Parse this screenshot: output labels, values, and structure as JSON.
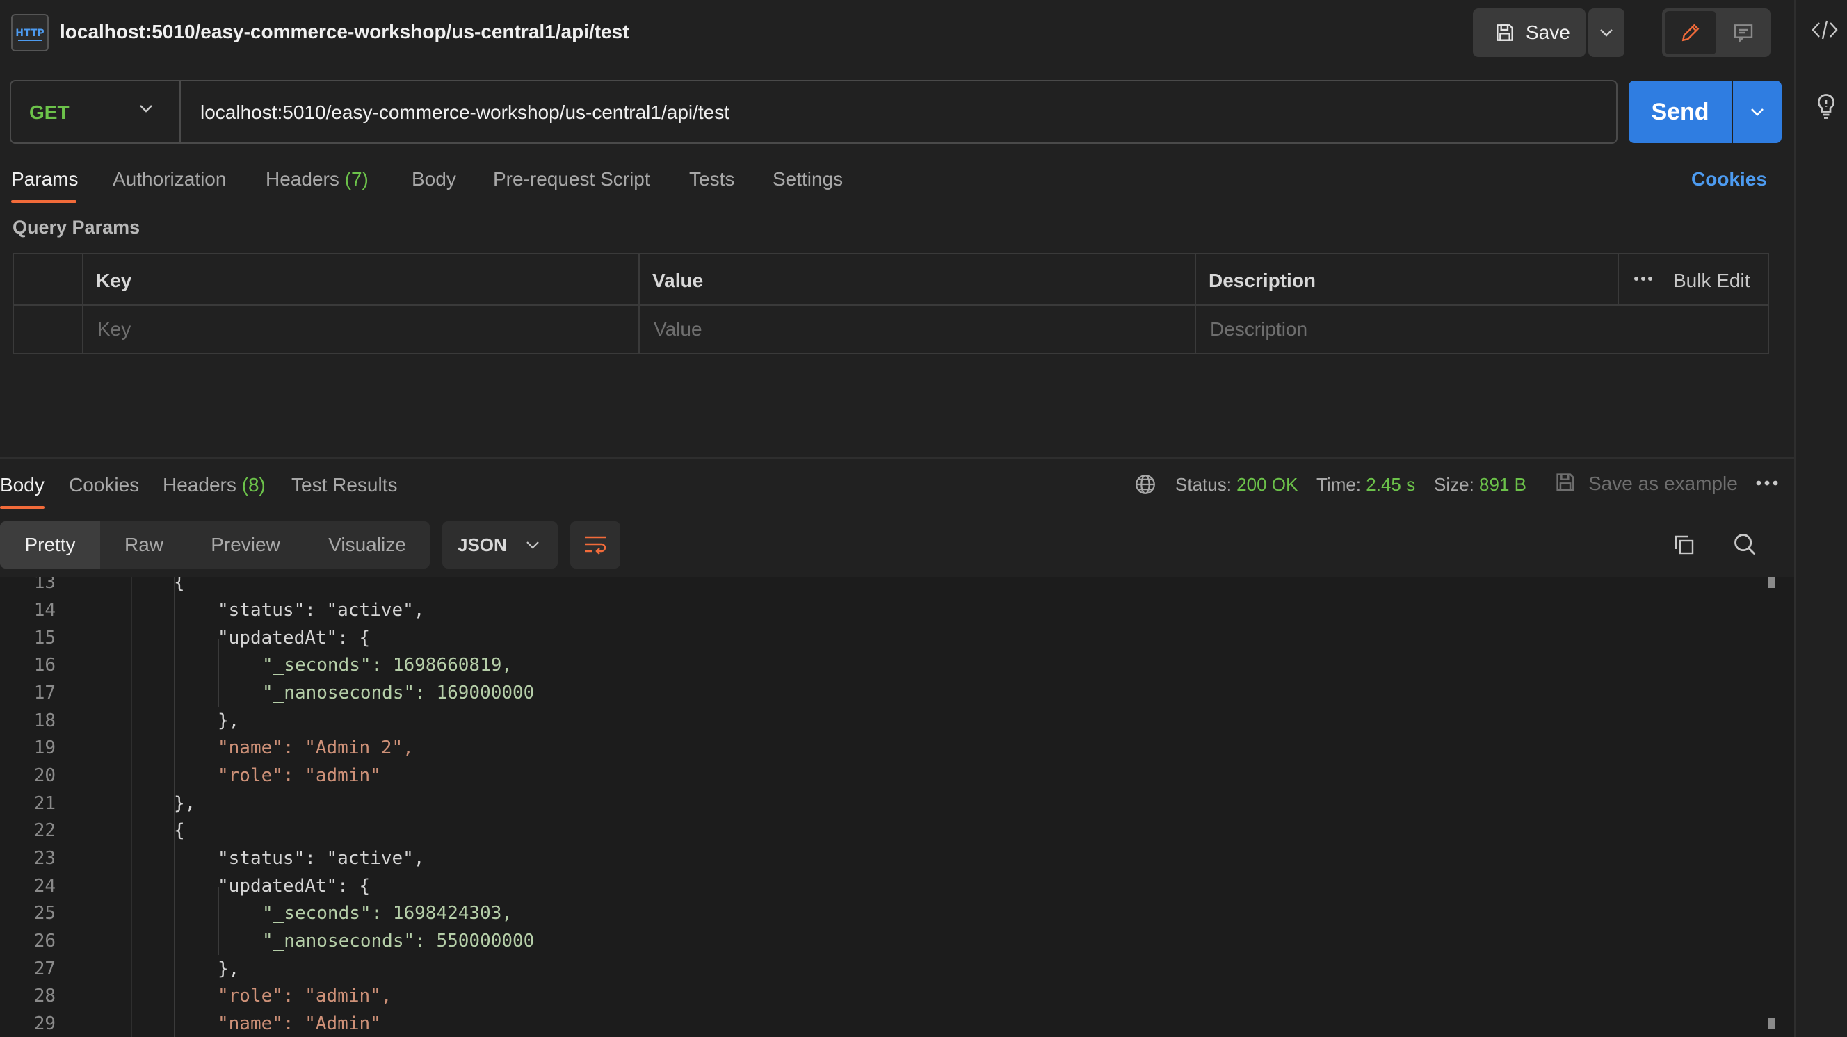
{
  "request": {
    "title": "localhost:5010/easy-commerce-workshop/us-central1/api/test",
    "method": "GET",
    "url": "localhost:5010/easy-commerce-workshop/us-central1/api/test",
    "save_label": "Save",
    "send_label": "Send"
  },
  "request_tabs": [
    {
      "label": "Params",
      "count": ""
    },
    {
      "label": "Authorization",
      "count": ""
    },
    {
      "label": "Headers",
      "count": "(7)"
    },
    {
      "label": "Body",
      "count": ""
    },
    {
      "label": "Pre-request Script",
      "count": ""
    },
    {
      "label": "Tests",
      "count": ""
    },
    {
      "label": "Settings",
      "count": ""
    }
  ],
  "cookies_link": "Cookies",
  "query_params": {
    "title": "Query Params",
    "headers": {
      "key": "Key",
      "value": "Value",
      "description": "Description",
      "bulk_edit": "Bulk Edit"
    },
    "placeholders": {
      "key": "Key",
      "value": "Value",
      "description": "Description"
    }
  },
  "response_tabs": [
    {
      "label": "Body",
      "count": ""
    },
    {
      "label": "Cookies",
      "count": ""
    },
    {
      "label": "Headers",
      "count": "(8)"
    },
    {
      "label": "Test Results",
      "count": ""
    }
  ],
  "response_status": {
    "status_label": "Status:",
    "status_value": "200 OK",
    "time_label": "Time:",
    "time_value": "2.45 s",
    "size_label": "Size:",
    "size_value": "891 B",
    "save_example": "Save as example"
  },
  "view_modes": [
    "Pretty",
    "Raw",
    "Preview",
    "Visualize"
  ],
  "format": "JSON",
  "code_lines": [
    {
      "n": "13",
      "text": "{"
    },
    {
      "n": "14",
      "text": "\"status\": \"active\","
    },
    {
      "n": "15",
      "text": "\"updatedAt\": {"
    },
    {
      "n": "16",
      "text": "\"_seconds\": 1698660819,"
    },
    {
      "n": "17",
      "text": "\"_nanoseconds\": 169000000"
    },
    {
      "n": "18",
      "text": "},"
    },
    {
      "n": "19",
      "text": "\"name\": \"Admin 2\","
    },
    {
      "n": "20",
      "text": "\"role\": \"admin\""
    },
    {
      "n": "21",
      "text": "},"
    },
    {
      "n": "22",
      "text": "{"
    },
    {
      "n": "23",
      "text": "\"status\": \"active\","
    },
    {
      "n": "24",
      "text": "\"updatedAt\": {"
    },
    {
      "n": "25",
      "text": "\"_seconds\": 1698424303,"
    },
    {
      "n": "26",
      "text": "\"_nanoseconds\": 550000000"
    },
    {
      "n": "27",
      "text": "},"
    },
    {
      "n": "28",
      "text": "\"role\": \"admin\","
    },
    {
      "n": "29",
      "text": "\"name\": \"Admin\""
    }
  ],
  "colors": {
    "accent_send": "#2f7de1",
    "status_green": "#6cc24a",
    "tab_underline": "#f26b3a",
    "link_blue": "#4d9bf0"
  }
}
